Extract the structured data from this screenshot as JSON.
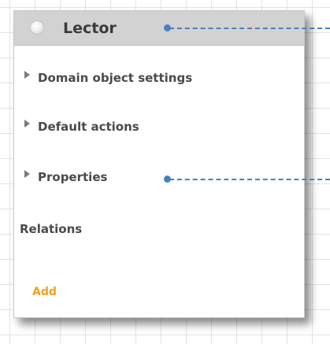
{
  "entity": {
    "title": "Lector",
    "status_icon": "circle-status-icon"
  },
  "sections": [
    {
      "label": "Domain object settings"
    },
    {
      "label": "Default actions"
    },
    {
      "label": "Properties"
    }
  ],
  "relations": {
    "label": "Relations",
    "add_label": "Add"
  },
  "colors": {
    "header_bg": "#d2d2d2",
    "connector": "#4a7fbf",
    "add_link": "#f0a020"
  }
}
